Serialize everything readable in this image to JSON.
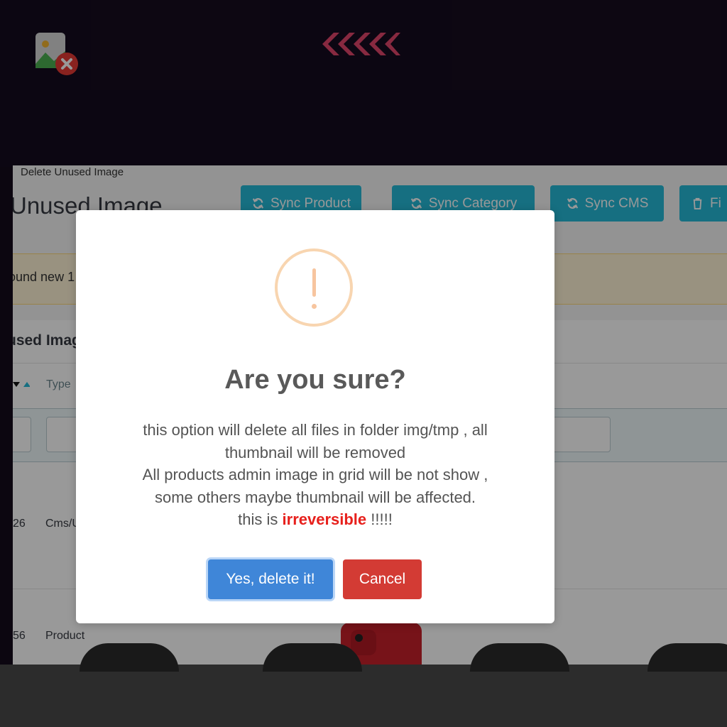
{
  "breadcrumb": "Delete Unused Image",
  "page_title": "Unused Image",
  "toolbar": {
    "sync_product": "Sync Product",
    "sync_category": "Sync Category",
    "sync_cms": "Sync CMS",
    "fourth_partial": "Fi"
  },
  "alert_text": "ound new 1",
  "panel_title": "used Imag",
  "table": {
    "type_header": "Type",
    "rows": [
      {
        "id": "26",
        "type": "Cms/U"
      },
      {
        "id": "56",
        "type": "Product"
      }
    ]
  },
  "dialog": {
    "title": "Are you sure?",
    "text_lines": [
      "this option will delete all files in folder img/tmp , all",
      "thumbnail will be removed",
      "All products admin image in grid will be not show ,",
      "some others maybe thumbnail will be affected."
    ],
    "last_line_prefix": "this is ",
    "last_line_emphasis": "irreversible",
    "last_line_suffix": " !!!!!",
    "confirm_label": "Yes, delete it!",
    "cancel_label": "Cancel"
  },
  "icons": {
    "app": "image-delete-icon",
    "chevrons": "chevrons-left-icon",
    "refresh": "refresh-icon",
    "trash": "trash-icon",
    "warning": "warning-icon"
  },
  "colors": {
    "toolbar_button": "#25b9d7",
    "confirm_button": "#3f86d8",
    "cancel_button": "#d33b34",
    "irreversible_text": "#e7201c",
    "warning_icon": "#f8d5b0"
  }
}
